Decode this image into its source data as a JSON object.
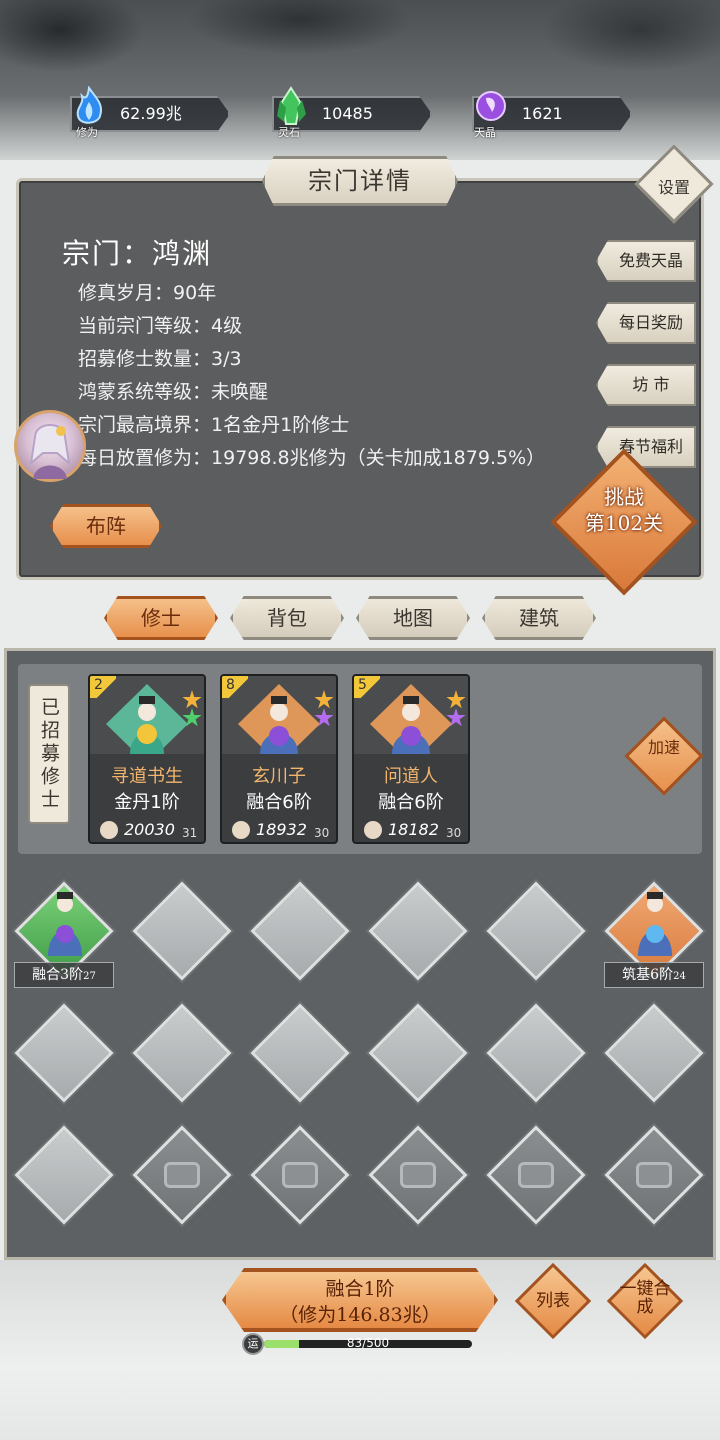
{
  "resources": [
    {
      "caption": "修为",
      "value": "62.99兆",
      "icon": "blue-flame-icon",
      "color": "#3aa6ff"
    },
    {
      "caption": "灵石",
      "value": "10485",
      "icon": "green-crystal-icon",
      "color": "#4fd06a"
    },
    {
      "caption": "天晶",
      "value": "1621",
      "icon": "purple-gem-icon",
      "color": "#b46df0"
    }
  ],
  "panel": {
    "title": "宗门详情",
    "settings_label": "设置",
    "sect_name": "宗门：鸿渊",
    "lines": [
      {
        "label": "修真岁月：",
        "value": "90年"
      },
      {
        "label": "当前宗门等级：",
        "value": "4级"
      },
      {
        "label": "招募修士数量：",
        "value": "3/3"
      },
      {
        "label": "鸿蒙系统等级：",
        "value": "未唤醒"
      },
      {
        "label": "宗门最高境界：",
        "value": "1名金丹1阶修士"
      },
      {
        "label": "每日放置修为：",
        "value": "19798.8兆修为（关卡加成1879.5%）"
      }
    ],
    "side_buttons": [
      "免费天晶",
      "每日奖励",
      "坊 市",
      "春节福利"
    ],
    "formation_label": "布阵",
    "challenge_line1": "挑战",
    "challenge_line2": "第102关"
  },
  "tabs": [
    "修士",
    "背包",
    "地图",
    "建筑"
  ],
  "active_tab": "修士",
  "recruited": {
    "tag": "已招募修士",
    "speedup_label": "加速",
    "cards": [
      {
        "level": "2",
        "name": "寻道书生",
        "realm": "金丹1阶",
        "power": "20030",
        "age": "31",
        "stars": [
          "#f4b23a",
          "#4fd06a"
        ],
        "bg": "#5ec3a2"
      },
      {
        "level": "8",
        "name": "玄川子",
        "realm": "融合6阶",
        "power": "18932",
        "age": "30",
        "stars": [
          "#f4b23a",
          "#b46df0"
        ],
        "bg": "#e79a5a"
      },
      {
        "level": "5",
        "name": "问道人",
        "realm": "融合6阶",
        "power": "18182",
        "age": "30",
        "stars": [
          "#f4b23a",
          "#b46df0"
        ],
        "bg": "#e79a5a"
      }
    ]
  },
  "slots": {
    "occupied": [
      {
        "label": "融合3阶",
        "sub": "27"
      },
      {
        "label": "筑基6阶",
        "sub": "24"
      }
    ]
  },
  "bottom": {
    "merge_line1": "融合1阶",
    "merge_line2": "（修为146.83兆）",
    "list_label": "列表",
    "auto_merge_label": "一键合成",
    "luck_icon": "运",
    "luck_text": "83/500",
    "luck_progress": 0.166
  }
}
